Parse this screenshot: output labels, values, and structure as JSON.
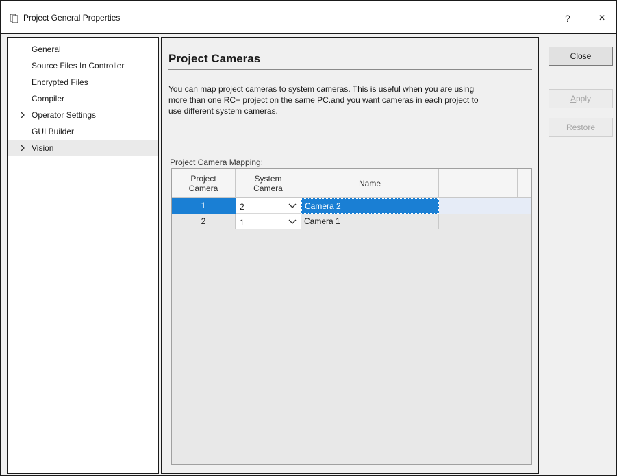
{
  "window": {
    "title": "Project General Properties",
    "help_label": "?",
    "close_glyph": "×",
    "app_icon": "copy-pages-icon"
  },
  "nav": {
    "items": [
      {
        "label": "General",
        "expandable": false,
        "selected": false
      },
      {
        "label": "Source Files In Controller",
        "expandable": false,
        "selected": false
      },
      {
        "label": "Encrypted Files",
        "expandable": false,
        "selected": false
      },
      {
        "label": "Compiler",
        "expandable": false,
        "selected": false
      },
      {
        "label": "Operator Settings",
        "expandable": true,
        "selected": false
      },
      {
        "label": "GUI Builder",
        "expandable": false,
        "selected": false
      },
      {
        "label": "Vision",
        "expandable": true,
        "selected": true
      }
    ]
  },
  "page": {
    "title": "Project Cameras",
    "description_lines": [
      "You can map project cameras to system cameras.  This is useful when you are using",
      "more than one RC+ project on the same PC.and you want cameras in each project to",
      "use different system cameras."
    ],
    "grid_label": "Project Camera Mapping:"
  },
  "grid": {
    "headers": {
      "project_camera": [
        "Project",
        "Camera"
      ],
      "system_camera": [
        "System",
        "Camera"
      ],
      "name": "Name"
    },
    "rows": [
      {
        "project_camera": "1",
        "system_camera": "2",
        "name": "Camera 2",
        "selected": true
      },
      {
        "project_camera": "2",
        "system_camera": "1",
        "name": "Camera 1",
        "selected": false
      }
    ]
  },
  "buttons": {
    "close": "Close",
    "apply_first": "A",
    "apply_rest": "pply",
    "restore_first": "R",
    "restore_rest": "estore"
  },
  "colors": {
    "selection": "#1a7fd4",
    "window_border": "#1a1a1a",
    "panel_bg": "#f0f0f0"
  }
}
